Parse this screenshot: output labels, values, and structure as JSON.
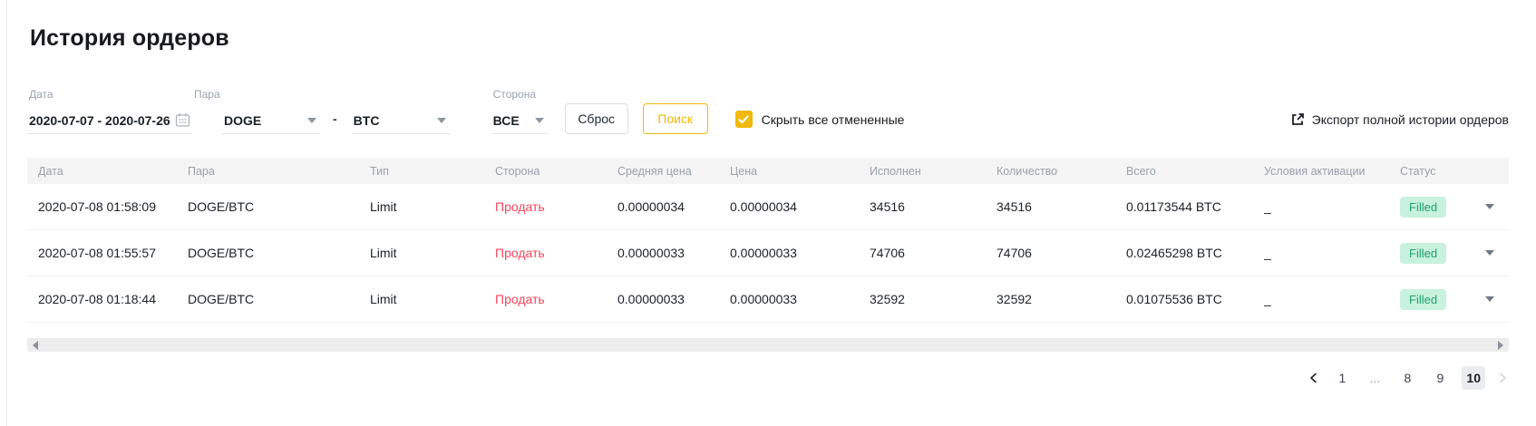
{
  "page": {
    "title": "История ордеров"
  },
  "filters": {
    "date": {
      "label": "Дата",
      "value": "2020-07-07 - 2020-07-26"
    },
    "pair": {
      "label": "Пара",
      "base": "DOGE",
      "separator": "-",
      "quote": "BTC"
    },
    "side": {
      "label": "Сторона",
      "value": "ВСЕ"
    },
    "reset_label": "Сброс",
    "search_label": "Поиск",
    "hide_cancelled": {
      "checked": true,
      "label": "Скрыть все отмененные"
    },
    "export_label": "Экспорт полной истории ордеров"
  },
  "table": {
    "headers": [
      "Дата",
      "Пара",
      "Тип",
      "Сторона",
      "Средняя цена",
      "Цена",
      "Исполнен",
      "Количество",
      "Всего",
      "Условия активации",
      "Статус"
    ],
    "rows": [
      {
        "date": "2020-07-08 01:58:09",
        "pair": "DOGE/BTC",
        "type": "Limit",
        "side": "Продать",
        "avg_price": "0.00000034",
        "price": "0.00000034",
        "filled": "34516",
        "amount": "34516",
        "total": "0.01173544 BTC",
        "trigger": "_",
        "status": "Filled"
      },
      {
        "date": "2020-07-08 01:55:57",
        "pair": "DOGE/BTC",
        "type": "Limit",
        "side": "Продать",
        "avg_price": "0.00000033",
        "price": "0.00000033",
        "filled": "74706",
        "amount": "74706",
        "total": "0.02465298 BTC",
        "trigger": "_",
        "status": "Filled"
      },
      {
        "date": "2020-07-08 01:18:44",
        "pair": "DOGE/BTC",
        "type": "Limit",
        "side": "Продать",
        "avg_price": "0.00000033",
        "price": "0.00000033",
        "filled": "32592",
        "amount": "32592",
        "total": "0.01075536 BTC",
        "trigger": "_",
        "status": "Filled"
      }
    ]
  },
  "pagination": {
    "pages": [
      "1",
      "...",
      "8",
      "9",
      "10"
    ],
    "current": "10"
  },
  "icons": [
    "calendar-icon",
    "chevron-down-icon",
    "export-icon",
    "check-icon",
    "scroll-left-icon",
    "scroll-right-icon",
    "chevron-left-icon",
    "chevron-right-icon",
    "expand-caret-icon"
  ],
  "colors": {
    "accent_yellow": "#F0B90B",
    "sell_red": "#F6465D",
    "filled_badge_bg": "#C8F2DE",
    "filled_badge_text": "#21A06D",
    "header_bg": "#F5F5F6",
    "text_dark": "#1B2026",
    "text_gray": "#9AA2AD"
  }
}
